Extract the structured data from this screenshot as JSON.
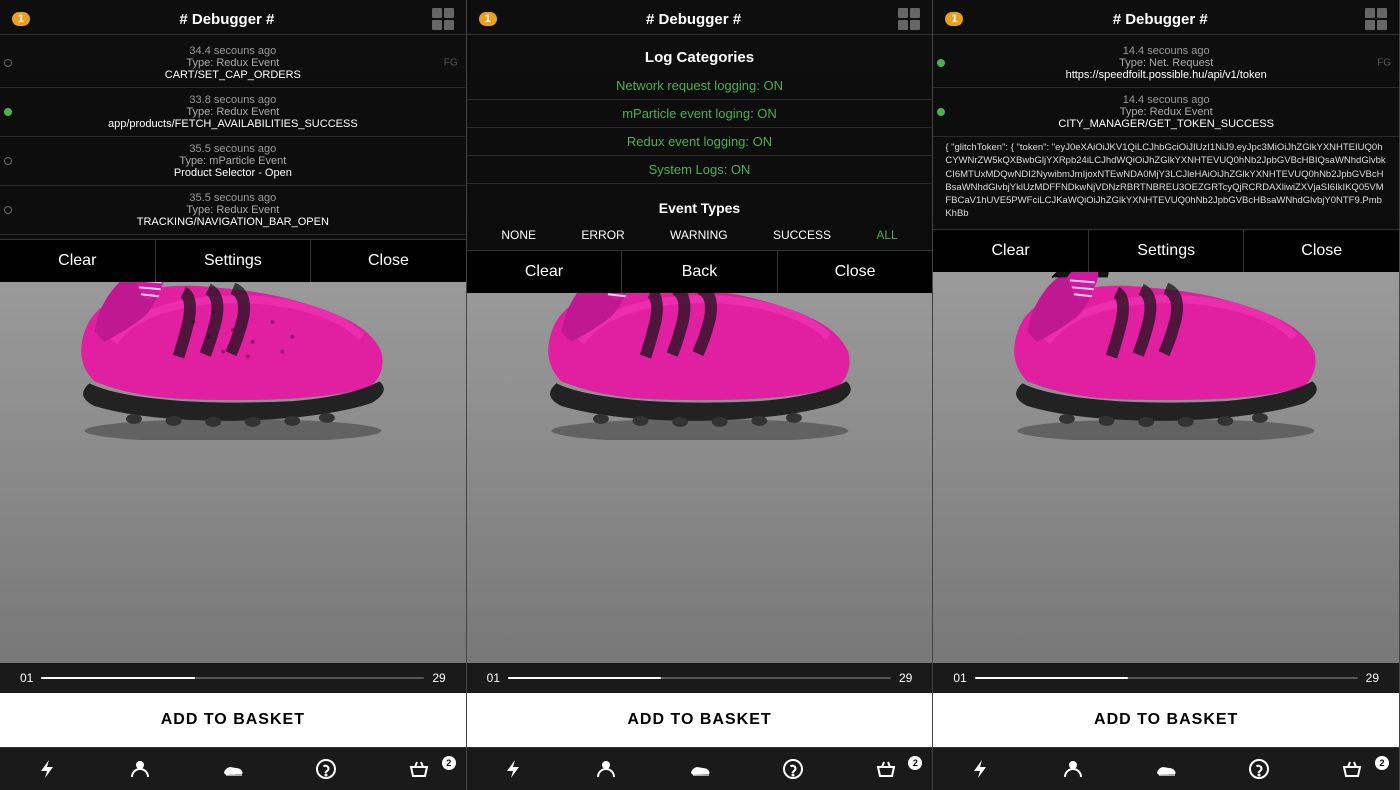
{
  "panels": [
    {
      "id": "panel-1",
      "debugger": {
        "title": "# Debugger #",
        "badge": "1",
        "mode": "logs",
        "logs": [
          {
            "time": "34.4 secouns ago",
            "type": "Type: Redux Event",
            "message": "CART/SET_CAP_ORDERS",
            "indicator": "empty",
            "fg": "FG"
          },
          {
            "time": "33.8 secouns ago",
            "type": "Type: Redux Event",
            "message": "app/products/FETCH_AVAILABILITIES_SUCCESS",
            "indicator": "green",
            "fg": ""
          },
          {
            "time": "35.5 secouns ago",
            "type": "Type: mParticle Event",
            "message": "Product Selector - Open",
            "indicator": "empty",
            "fg": ""
          },
          {
            "time": "35.5 secouns ago",
            "type": "Type: Redux Event",
            "message": "TRACKING/NAVIGATION_BAR_OPEN",
            "indicator": "empty",
            "fg": ""
          }
        ],
        "footer": [
          "Clear",
          "Settings",
          "Close"
        ]
      },
      "sizes": {
        "min": "01",
        "max": "29"
      },
      "addToBasket": "ADD TO BASKET",
      "nav": {
        "items": [
          "⚡",
          "👤",
          "👟",
          "?",
          "🛒"
        ],
        "active": 2,
        "badge_index": 4,
        "badge_value": "2"
      }
    },
    {
      "id": "panel-2",
      "debugger": {
        "title": "# Debugger #",
        "badge": "1",
        "mode": "categories",
        "categories_title": "Log Categories",
        "categories": [
          "Network request logging: ON",
          "mParticle event loging: ON",
          "Redux event logging: ON",
          "System Logs: ON"
        ],
        "event_types_title": "Event Types",
        "event_types": [
          "NONE",
          "ERROR",
          "WARNING",
          "SUCCESS",
          "ALL"
        ],
        "event_types_active": "ALL",
        "footer": [
          "Clear",
          "Back",
          "Close"
        ]
      },
      "sizes": {
        "min": "01",
        "max": "29"
      },
      "addToBasket": "ADD TO BASKET",
      "nav": {
        "items": [
          "⚡",
          "👤",
          "👟",
          "?",
          "🛒"
        ],
        "active": 2,
        "badge_index": 4,
        "badge_value": "2"
      }
    },
    {
      "id": "panel-3",
      "debugger": {
        "title": "# Debugger #",
        "badge": "1",
        "mode": "detail",
        "logs": [
          {
            "time": "14.4 secouns ago",
            "type": "Type: Net. Request",
            "message": "https://speedfoilt.possible.hu/api/v1/token",
            "indicator": "green",
            "fg": "FG"
          },
          {
            "time": "14.4 secouns ago",
            "type": "Type: Redux Event",
            "message": "CITY_MANAGER/GET_TOKEN_SUCCESS",
            "indicator": "green",
            "fg": ""
          }
        ],
        "detail_json": "{\n  \"glitchToken\": {\n    \"token\":\n\"eyJ0eXAiOiJKV1QiLCJhbGciOiJIUzI1NiJ9.eyJpc3MiOiJhZGlkYXNHTEIUQ0hCYWNrZW5kQXBwbGljYXRpb24iLCJhdWQiOiJhZGlkYXNHTEVUQ0hNb2JpbGVBcHBIQsaWNhdGlvbkCI6MTUxMDQwNDI2NywibmJmIjoxNTEwNDA0MjY3LCJleHAiOiJhZGlkYXNHTEVUQ0hNb2JpbGVBcHBsaWNhdGlvbjYklUzMDFFNDkwNjVDNzRBRTNBREU3OEZGRTcyQjRCRDAXliwiZXVjaSI6IkIKQ05VMFBCaV1hUVE5PWFciLCJKaWQiOiJhZGlkYXNHTEVUQ0hNb2JpbGVBcHBsaWNhdGlvbjY0NTF9.PmbKhBb",
        "footer": [
          "Clear",
          "Settings",
          "Close"
        ]
      },
      "sizes": {
        "min": "01",
        "max": "29"
      },
      "addToBasket": "ADD TO BASKET",
      "nav": {
        "items": [
          "⚡",
          "👤",
          "👟",
          "?",
          "🛒"
        ],
        "active": 2,
        "badge_index": 4,
        "badge_value": "2"
      }
    }
  ],
  "icons": {
    "bolt": "⚡",
    "person": "♟",
    "shoe": "👟",
    "help": "?",
    "basket": "🛒",
    "grid": "⊞"
  }
}
